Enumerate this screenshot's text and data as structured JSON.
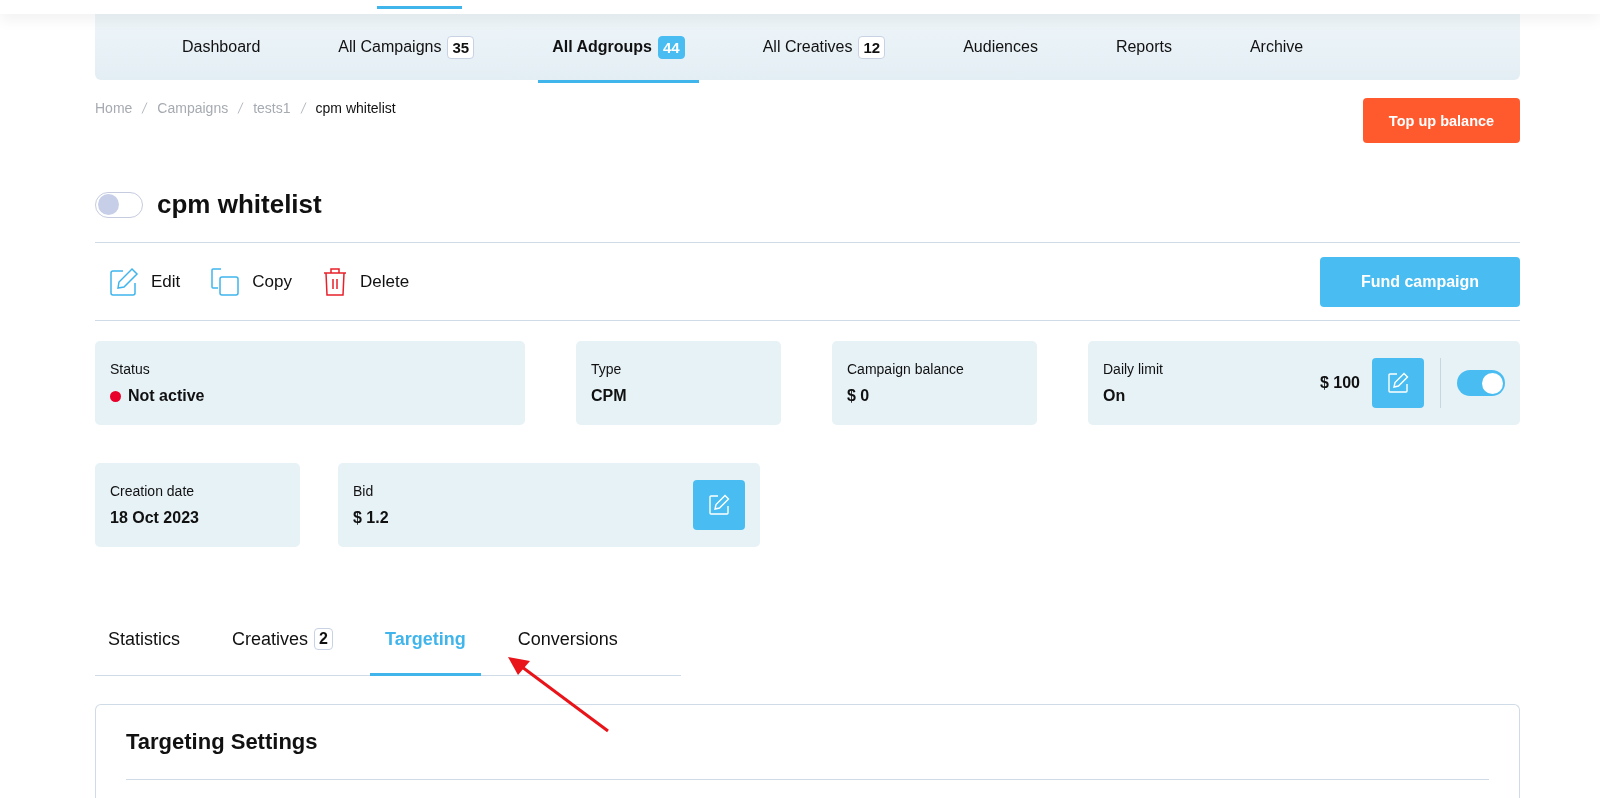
{
  "nav": [
    {
      "label": "Dashboard",
      "selected": false
    },
    {
      "label": "All Campaigns",
      "count": "35",
      "selected": false
    },
    {
      "label": "All Adgroups",
      "count": "44",
      "selected": true
    },
    {
      "label": "All Creatives",
      "count": "12",
      "selected": false
    },
    {
      "label": "Audiences",
      "selected": false
    },
    {
      "label": "Reports",
      "selected": false
    },
    {
      "label": "Archive",
      "selected": false
    }
  ],
  "breadcrumbs": [
    "Home",
    "Campaigns",
    "tests1",
    "cpm whitelist"
  ],
  "top_up_button": "Top up balance",
  "title": {
    "text": "cpm whitelist",
    "toggle_on": false
  },
  "actions": [
    {
      "kind": "edit",
      "label": "Edit"
    },
    {
      "kind": "copy",
      "label": "Copy"
    },
    {
      "kind": "delete",
      "label": "Delete"
    }
  ],
  "fund_button": "Fund campaign",
  "card_rows": [
    [
      {
        "label": "Status",
        "value": "Not active",
        "kind": "status"
      },
      {
        "label": "Type",
        "value": "CPM",
        "kind": "plain"
      },
      {
        "label": "Campaign balance",
        "value": "$ 0",
        "kind": "plain"
      },
      {
        "label": "Daily limit",
        "value": "On",
        "kind": "limit",
        "amount": "$ 100",
        "toggle_on": true
      }
    ],
    [
      {
        "label": "Creation date",
        "value": "18 Oct 2023",
        "kind": "plain"
      },
      {
        "label": "Bid",
        "value": "$ 1.2",
        "kind": "editable"
      }
    ]
  ],
  "tabs": [
    {
      "label": "Statistics",
      "selected": false
    },
    {
      "label": "Creatives",
      "count": "2",
      "selected": false
    },
    {
      "label": "Targeting",
      "selected": true
    },
    {
      "label": "Conversions",
      "selected": false
    }
  ],
  "panel": {
    "title": "Targeting Settings"
  }
}
